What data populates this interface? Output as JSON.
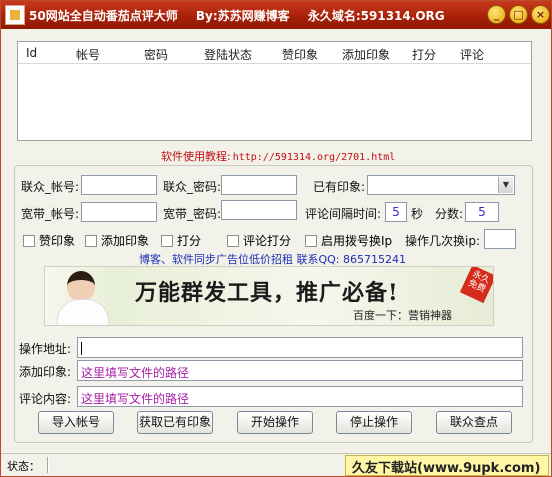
{
  "window": {
    "title_parts": [
      "50网站全自动番茄点评大师",
      "By:苏苏网赚博客",
      "永久域名:591314.ORG"
    ],
    "controls": [
      "_",
      "□",
      "×"
    ]
  },
  "list": {
    "columns": [
      "Id",
      "帐号",
      "密码",
      "登陆状态",
      "赞印象",
      "添加印象",
      "打分",
      "评论"
    ]
  },
  "tutorial": {
    "label": "软件使用教程:",
    "url": "http://591314.org/2701.html"
  },
  "form": {
    "lianzhong_account_label": "联众_帐号:",
    "lianzhong_account_value": "",
    "lianzhong_password_label": "联众_密码:",
    "lianzhong_password_value": "",
    "existing_impression_label": "已有印象:",
    "existing_impression_value": "",
    "broadband_account_label": "宽带_帐号:",
    "broadband_account_value": "",
    "broadband_password_label": "宽带_密码:",
    "broadband_password_value": "",
    "comment_interval_label": "评论间隔时间:",
    "comment_interval_value": "5",
    "seconds_label": "秒",
    "score_label": "分数:",
    "score_value": "5",
    "checkboxes": {
      "like_impression": "赞印象",
      "add_impression": "添加印象",
      "score": "打分",
      "comment_score": "评论打分",
      "enable_dialup": "启用拨号换Ip"
    },
    "switch_ip_label": "操作几次换ip:",
    "switch_ip_value": ""
  },
  "ad_line": "博客、软件同步广告位低价招租  联系QQ: 865715241",
  "banner": {
    "main_text": "万能群发工具，推广必备!",
    "sub_text": "百度一下：营销神器",
    "badge": "永久免费"
  },
  "paths": {
    "operation_address_label": "操作地址:",
    "operation_address_value": "",
    "add_impression_label": "添加印象:",
    "add_impression_value": "这里填写文件的路径",
    "comment_content_label": "评论内容:",
    "comment_content_value": "这里填写文件的路径"
  },
  "buttons": {
    "import_accounts": "导入帐号",
    "get_impressions": "获取已有印象",
    "start": "开始操作",
    "stop": "停止操作",
    "lianzhong_check": "联众查点"
  },
  "status": {
    "label": "状态：",
    "watermark": "久友下载站(www.9upk.com)"
  }
}
